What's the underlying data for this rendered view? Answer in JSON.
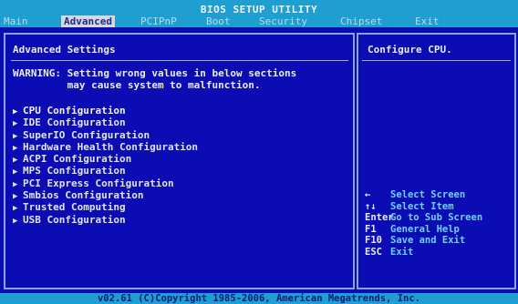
{
  "header": {
    "title": "BIOS SETUP UTILITY",
    "tabs": [
      {
        "label": "Main"
      },
      {
        "label": "Advanced"
      },
      {
        "label": "PCIPnP"
      },
      {
        "label": "Boot"
      },
      {
        "label": "Security"
      },
      {
        "label": "Chipset"
      },
      {
        "label": "Exit"
      }
    ],
    "active_tab": "Advanced"
  },
  "left": {
    "title": "Advanced Settings",
    "warning_line1": "WARNING: Setting wrong values in below sections",
    "warning_line2": "         may cause system to malfunction.",
    "items": [
      {
        "label": "CPU Configuration"
      },
      {
        "label": "IDE Configuration"
      },
      {
        "label": "SuperIO Configuration"
      },
      {
        "label": "Hardware Health Configuration"
      },
      {
        "label": "ACPI Configuration"
      },
      {
        "label": "MPS Configuration"
      },
      {
        "label": "PCI Express Configuration"
      },
      {
        "label": "Smbios Configuration"
      },
      {
        "label": "Trusted Computing"
      },
      {
        "label": "USB Configuration"
      }
    ],
    "selected_item": "CPU Configuration",
    "arrow_glyph": "▶"
  },
  "right": {
    "help_text": "Configure CPU.",
    "legend": [
      {
        "key": "←",
        "desc": "Select Screen"
      },
      {
        "key": "↑↓",
        "desc": "Select Item"
      },
      {
        "key": "Enter",
        "desc": "Go to Sub Screen"
      },
      {
        "key": "F1",
        "desc": "General Help"
      },
      {
        "key": "F10",
        "desc": "Save and Exit"
      },
      {
        "key": "ESC",
        "desc": "Exit"
      }
    ]
  },
  "footer": {
    "copyright": "v02.61 (C)Copyright 1985-2006, American Megatrends, Inc."
  },
  "colors": {
    "background": "#0c0cb4",
    "bar": "#1f9fd0",
    "active_tab_bg": "#d8d8d8",
    "legend_desc": "#6fd0f8",
    "text": "#e0e4ee"
  }
}
